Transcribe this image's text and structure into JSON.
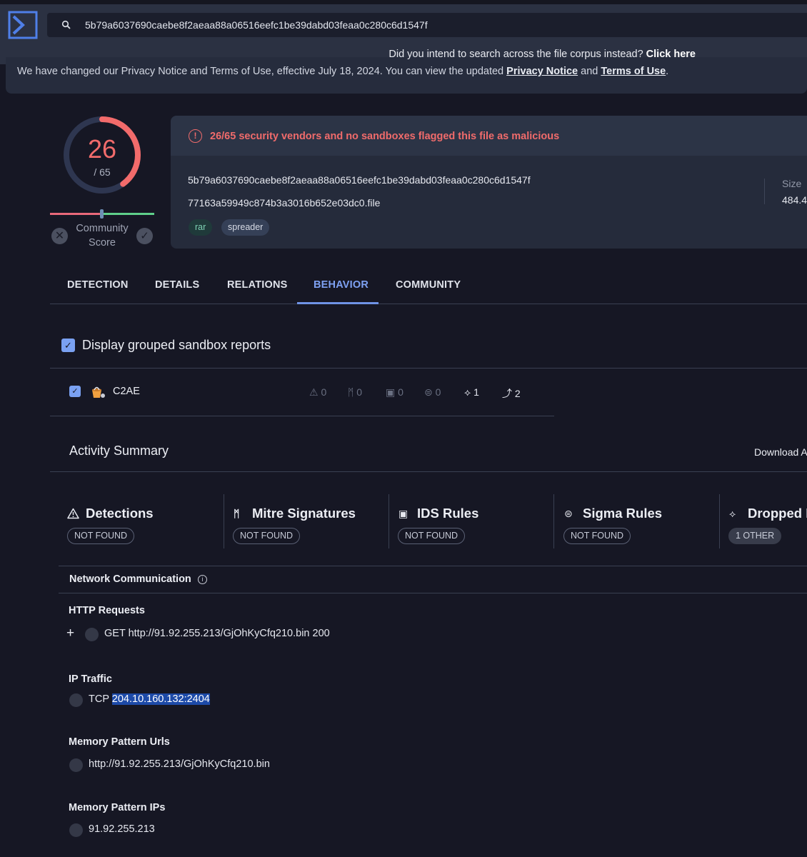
{
  "search": {
    "value": "5b79a6037690caebe8f2aeaa88a06516eefc1be39dabd03feaa0c280c6d1547f"
  },
  "corpus_prompt": {
    "text": "Did you intend to search across the file corpus instead?",
    "link": "Click here"
  },
  "privacy": {
    "text": "We have changed our Privacy Notice and Terms of Use, effective July 18, 2024. You can view the updated",
    "link1": "Privacy Notice",
    "and": "and",
    "link2": "Terms of Use",
    "end": "."
  },
  "score": {
    "detections": "26",
    "total": "/ 65",
    "detection_fraction": 0.4,
    "community_label": "Community Score"
  },
  "file": {
    "alert": "26/65 security vendors and no sandboxes flagged this file as malicious",
    "hash": "5b79a6037690caebe8f2aeaa88a06516eefc1be39dabd03feaa0c280c6d1547f",
    "name": "77163a59949c874b3a3016b652e03dc0.file",
    "tags": [
      "rar",
      "spreader"
    ],
    "size_label": "Size",
    "size_value": "484.4"
  },
  "tabs": [
    "DETECTION",
    "DETAILS",
    "RELATIONS",
    "BEHAVIOR",
    "COMMUNITY"
  ],
  "active_tab": "BEHAVIOR",
  "grouped": {
    "label": "Display grouped sandbox reports",
    "checked": true
  },
  "sandbox": {
    "name": "C2AE",
    "stats": [
      "0",
      "0",
      "0",
      "0",
      "1",
      "2"
    ]
  },
  "activity": {
    "title": "Activity Summary",
    "download": "Download A",
    "columns": [
      {
        "icon": "warning-icon",
        "title": "Detections",
        "badge": "NOT FOUND"
      },
      {
        "icon": "mitre-icon",
        "title": "Mitre Signatures",
        "badge": "NOT FOUND"
      },
      {
        "icon": "ids-icon",
        "title": "IDS Rules",
        "badge": "NOT FOUND"
      },
      {
        "icon": "sigma-icon",
        "title": "Sigma Rules",
        "badge": "NOT FOUND"
      },
      {
        "icon": "dropped-icon",
        "title": "Dropped F",
        "badge": "1 OTHER"
      }
    ]
  },
  "network": {
    "title": "Network Communication",
    "http_title": "HTTP Requests",
    "http_row": "GET http://91.92.255.213/GjOhKyCfq210.bin 200",
    "ip_title": "IP Traffic",
    "ip_proto": "TCP",
    "ip_addr": "204.10.160.132:2404",
    "mem_urls_title": "Memory Pattern Urls",
    "mem_url": "http://91.92.255.213/GjOhKyCfq210.bin",
    "mem_ips_title": "Memory Pattern IPs",
    "mem_ip": "91.92.255.213"
  },
  "colors": {
    "accent": "#7ea1f2",
    "malicious": "#f06b6b",
    "background": "#161724"
  }
}
